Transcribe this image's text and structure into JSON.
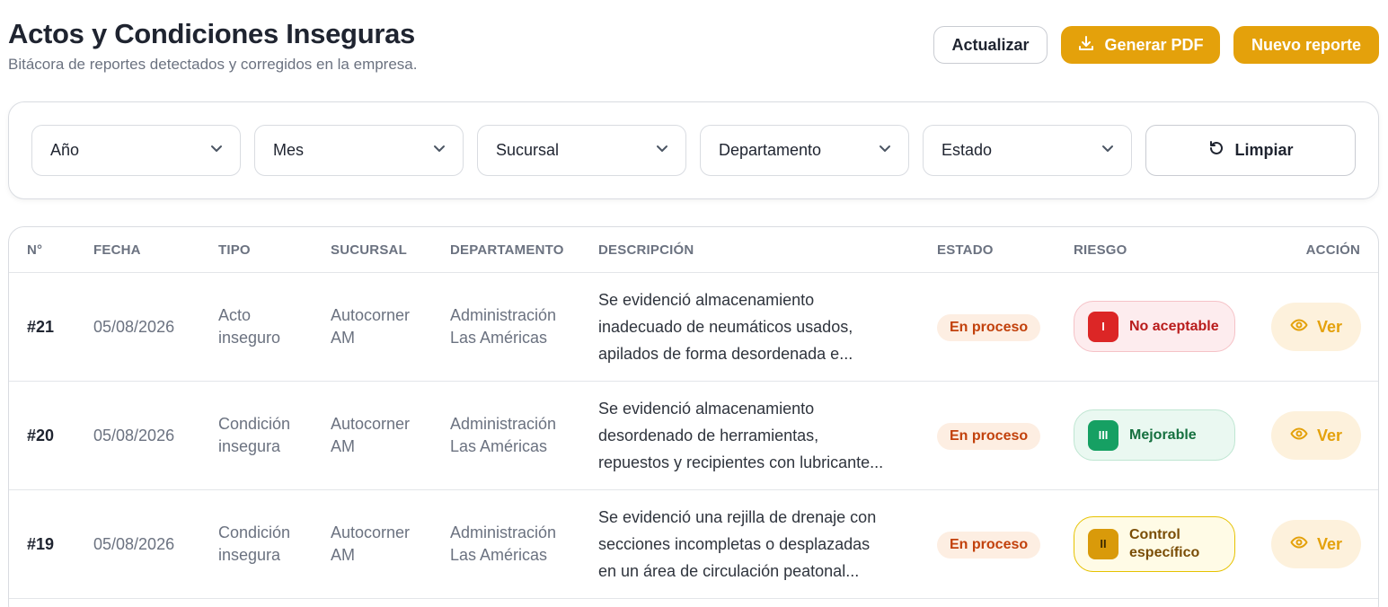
{
  "header": {
    "title": "Actos y Condiciones Inseguras",
    "subtitle": "Bitácora de reportes detectados y corregidos en la empresa."
  },
  "actions": {
    "refresh_label": "Actualizar",
    "pdf_label": "Generar PDF",
    "new_label": "Nuevo reporte"
  },
  "filters": {
    "year": "Año",
    "month": "Mes",
    "branch": "Sucursal",
    "department": "Departamento",
    "status": "Estado",
    "clear_label": "Limpiar"
  },
  "table": {
    "headers": {
      "num": "N°",
      "date": "FECHA",
      "type": "TIPO",
      "branch": "SUCURSAL",
      "department": "DEPARTAMENTO",
      "description": "DESCRIPCIÓN",
      "status": "ESTADO",
      "risk": "RIESGO",
      "action": "ACCIÓN"
    },
    "rows": [
      {
        "num": "#21",
        "date": "05/08/2026",
        "type_1": "Acto",
        "type_2": "inseguro",
        "branch_1": "Autocorner",
        "branch_2": "AM",
        "dept_1": "Administración",
        "dept_2": "Las Américas",
        "desc_1": "Se evidenció almacenamiento",
        "desc_2": "inadecuado de neumáticos usados,",
        "desc_3": "apilados de forma desordenada e...",
        "status": "En proceso",
        "risk_level": "I",
        "risk_label": "No aceptable",
        "risk_color": "#dc2626",
        "action_label": "Ver"
      },
      {
        "num": "#20",
        "date": "05/08/2026",
        "type_1": "Condición",
        "type_2": "insegura",
        "branch_1": "Autocorner",
        "branch_2": "AM",
        "dept_1": "Administración",
        "dept_2": "Las Américas",
        "desc_1": "Se evidenció almacenamiento",
        "desc_2": "desordenado de herramientas,",
        "desc_3": "repuestos y recipientes con lubricante...",
        "status": "En proceso",
        "risk_level": "III",
        "risk_label": "Mejorable",
        "risk_color": "#16a063",
        "action_label": "Ver"
      },
      {
        "num": "#19",
        "date": "05/08/2026",
        "type_1": "Condición",
        "type_2": "insegura",
        "branch_1": "Autocorner",
        "branch_2": "AM",
        "dept_1": "Administración",
        "dept_2": "Las Américas",
        "desc_1": "Se evidenció una rejilla de drenaje con",
        "desc_2": "secciones incompletas o desplazadas",
        "desc_3": "en un área de circulación peatonal...",
        "status": "En proceso",
        "risk_level": "II",
        "risk_label_1": "Control",
        "risk_label_2": "específico",
        "risk_color": "#d99a0a",
        "action_label": "Ver"
      }
    ]
  },
  "colors": {
    "accent": "#e4a10b",
    "status_bg": "#fdeee2",
    "status_text": "#c2410c"
  },
  "icons": [
    "download-icon",
    "chevron-down-icon",
    "refresh-icon",
    "eye-icon"
  ]
}
